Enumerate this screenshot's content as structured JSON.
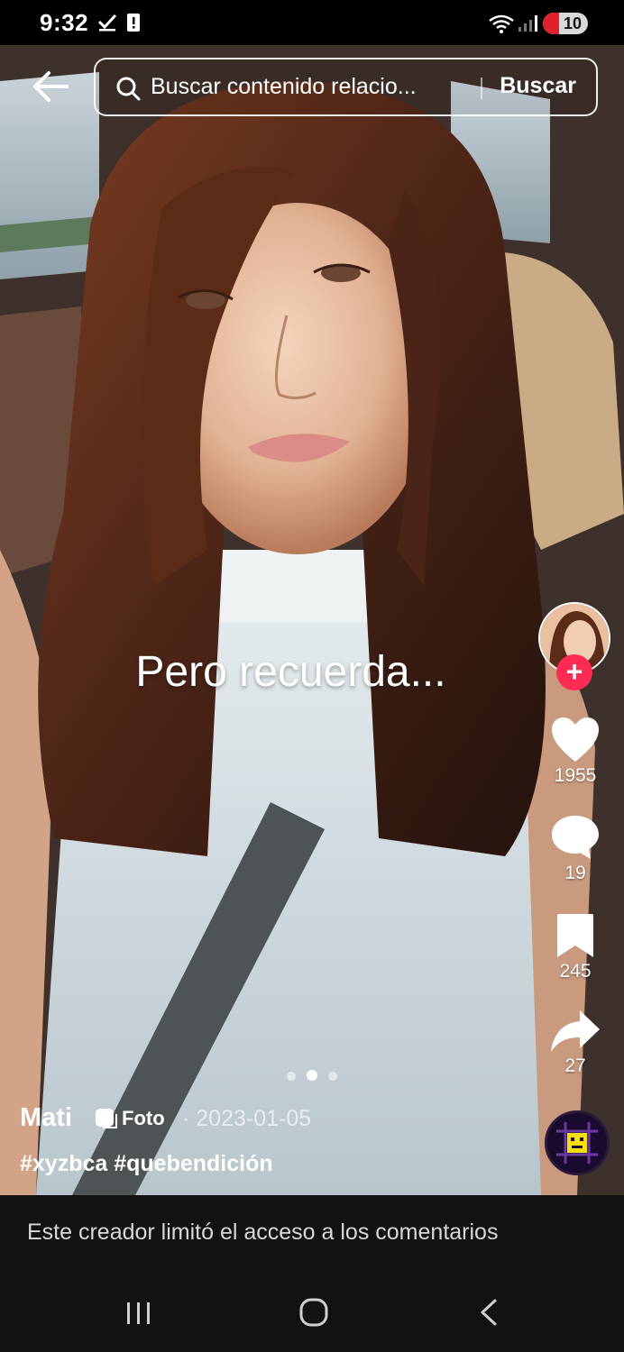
{
  "status_bar": {
    "time": "9:32",
    "battery_level": "10",
    "icons": [
      "check-icon",
      "alert-icon",
      "wifi-icon",
      "signal-icon",
      "battery-icon"
    ]
  },
  "search": {
    "query": "Buscar contenido relacio...",
    "button_label": "Buscar"
  },
  "post": {
    "overlay_text": "Pero recuerda...",
    "author": "Mati",
    "type_label": "Foto",
    "date": "· 2023-01-05",
    "hashtags": "#xyzbca #quebendición",
    "slide_count": 3,
    "active_slide": 2
  },
  "actions": {
    "likes": "1955",
    "comments": "19",
    "saves": "245",
    "shares": "27"
  },
  "comments_notice": "Este creador limitó el acceso a los comentarios",
  "colors": {
    "follow_button": "#fe2c55",
    "background": "#000000",
    "bottom_bar": "#121212"
  }
}
